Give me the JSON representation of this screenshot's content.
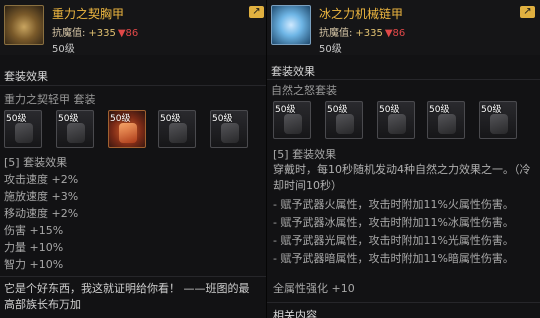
{
  "left": {
    "item_name": "重力之契胸甲",
    "stat_label": "抗魔值:",
    "stat_up": "+335",
    "stat_down": "▼86",
    "level": "50级",
    "section_title": "套装效果",
    "set_name": "重力之契轻甲 套装",
    "slot_level": "50级",
    "effects_title": "[5] 套装效果",
    "effects": [
      "攻击速度 +2%",
      "施放速度 +3%",
      "移动速度 +2%",
      "伤害 +15%",
      "力量 +10%",
      "智力 +10%"
    ],
    "flavor": "它是个好东西，我这就证明给你看！ ——班图的最高部族长布万加"
  },
  "right": {
    "item_name": "冰之力机械链甲",
    "stat_label": "抗魔值:",
    "stat_up": "+335",
    "stat_down": "▼86",
    "level": "50级",
    "section_title": "套装效果",
    "set_name": "自然之怒套装",
    "slot_level": "50级",
    "effects_title": "[5] 套装效果",
    "description": "穿戴时，每10秒随机发动4种自然之力效果之一。（冷却时间10秒）",
    "bullets": [
      "- 赋予武器火属性，攻击时附加11%火属性伤害。",
      "- 赋予武器冰属性，攻击时附加11%冰属性伤害。",
      "- 赋予武器光属性，攻击时附加11%光属性伤害。",
      "- 赋予武器暗属性，攻击时附加11%暗属性伤害。"
    ],
    "enhance": "全属性强化 +10",
    "related": "相关内容"
  },
  "icons": {
    "compare": "compare-arrow-icon"
  }
}
